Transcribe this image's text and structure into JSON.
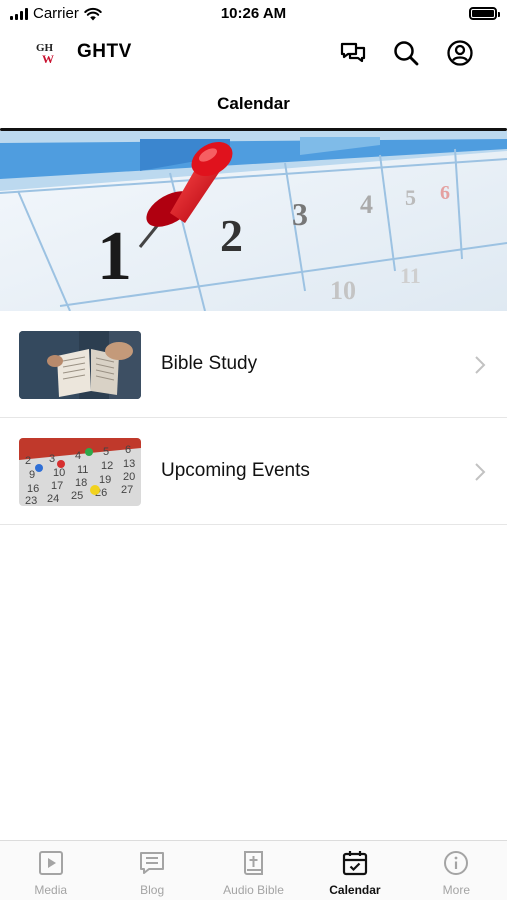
{
  "status_bar": {
    "carrier": "Carrier",
    "time": "10:26 AM"
  },
  "app_bar": {
    "title": "GHTV",
    "logo_text": "GHW",
    "icons": [
      "chat-icon",
      "search-icon",
      "account-icon"
    ]
  },
  "page": {
    "title": "Calendar"
  },
  "hero": {
    "description_icon": "calendar-pushpin-banner",
    "visible_numbers": [
      "1",
      "2",
      "3"
    ]
  },
  "list": {
    "items": [
      {
        "label": "Bible Study",
        "thumb": "open-bible-thumbnail"
      },
      {
        "label": "Upcoming Events",
        "thumb": "calendar-pins-thumbnail"
      }
    ]
  },
  "tab_bar": {
    "tabs": [
      {
        "label": "Media",
        "icon": "play-icon",
        "active": false
      },
      {
        "label": "Blog",
        "icon": "message-icon",
        "active": false
      },
      {
        "label": "Audio Bible",
        "icon": "bible-icon",
        "active": false
      },
      {
        "label": "Calendar",
        "icon": "calendar-icon",
        "active": true
      },
      {
        "label": "More",
        "icon": "info-icon",
        "active": false
      }
    ]
  },
  "colors": {
    "accent": "#111111",
    "inactive": "#a4a4a4",
    "pin_red": "#e0121d",
    "calendar_blue": "#3e8fd8"
  }
}
